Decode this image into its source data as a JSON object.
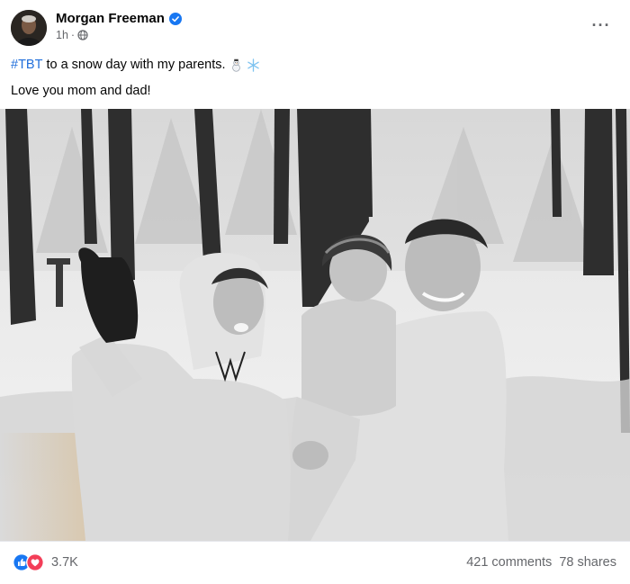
{
  "post": {
    "author": "Morgan Freeman",
    "time": "1h",
    "separator": "·",
    "privacy_icon": "globe-icon",
    "more_icon": "more-options-icon",
    "more_label": "···"
  },
  "text": {
    "hashtag": "#TBT",
    "line1_rest": "to a snow day with my parents.",
    "line1_emojis": [
      "snowman-emoji",
      "snowflake-emoji"
    ],
    "line2": "Love you mom and dad!"
  },
  "photo": {
    "description_icon": "family-snow-photo"
  },
  "footer": {
    "reaction_icons": [
      "like-reaction-icon",
      "love-reaction-icon"
    ],
    "reaction_count": "3.7K",
    "comments": "421 comments",
    "shares": "78 shares"
  },
  "colors": {
    "link_blue": "#216fdb",
    "secondary_text": "#65676b",
    "like_blue": "#1877f2",
    "love_red": "#f33e58",
    "verified_blue": "#1877f2"
  }
}
